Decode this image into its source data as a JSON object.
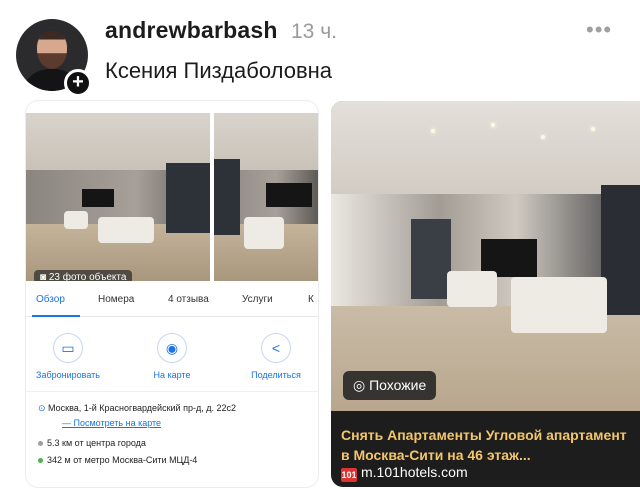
{
  "post": {
    "username": "andrewbarbash",
    "time": "13 ч.",
    "more_icon": "•••",
    "caption": "Ксения Пиздаболовна",
    "add_icon": "+"
  },
  "left_card": {
    "photo_count": "23 фото объекта",
    "tabs": [
      "Обзор",
      "Номера",
      "4 отзыва",
      "Услуги",
      "К"
    ],
    "actions": [
      {
        "icon": "bed-icon",
        "glyph": "▭",
        "label": "Забронировать"
      },
      {
        "icon": "pin-icon",
        "glyph": "◉",
        "label": "На карте"
      },
      {
        "icon": "share-icon",
        "glyph": "<",
        "label": "Поделиться"
      }
    ],
    "address": "Москва, 1-й Красногвардейский пр-д, д. 22с2",
    "map_link": "— Посмотреть на карте",
    "distance": "5.3 км от центра города",
    "metro": "342 м от метро Москва-Сити МЦД-4",
    "colors": {
      "accent": "#1a73e8",
      "metro_dot": "#4caf50",
      "center_dot": "#9e9e9e"
    }
  },
  "right_card": {
    "similar_label": "Похожие",
    "title": "Снять Апартаменты Угловой апартамент в Москва-Сити на 46 этаж...",
    "source_icon": "101",
    "source": "m.101hotels.com",
    "colors": {
      "title": "#f3c66b"
    }
  }
}
